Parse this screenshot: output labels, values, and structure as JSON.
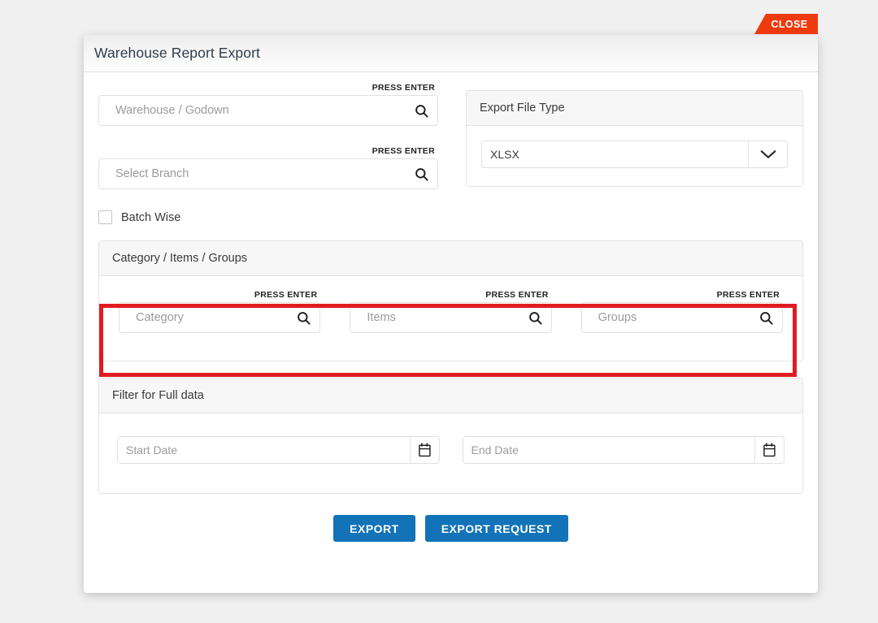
{
  "window": {
    "background_color": "#f0f0f0"
  },
  "close_button": {
    "label": "CLOSE",
    "color": "#ed3b0e"
  },
  "modal": {
    "title": "Warehouse Report Export"
  },
  "warehouse_field": {
    "placeholder": "Warehouse / Godown",
    "value": "",
    "hint": "PRESS ENTER",
    "icon": "search-icon"
  },
  "branch_field": {
    "placeholder": "Select Branch",
    "value": "",
    "hint": "PRESS ENTER",
    "icon": "search-icon"
  },
  "batch_wise": {
    "label": "Batch Wise",
    "checked": false
  },
  "export_file_type": {
    "panel_title": "Export File Type",
    "selected": "XLSX",
    "options": [
      "XLSX"
    ],
    "icon": "chevron-down-icon"
  },
  "category_panel": {
    "panel_title": "Category / Items / Groups",
    "fields": [
      {
        "placeholder": "Category",
        "value": "",
        "hint": "PRESS ENTER",
        "icon": "search-icon"
      },
      {
        "placeholder": "Items",
        "value": "",
        "hint": "PRESS ENTER",
        "icon": "search-icon"
      },
      {
        "placeholder": "Groups",
        "value": "",
        "hint": "PRESS ENTER",
        "icon": "search-icon"
      }
    ],
    "highlight_color": "#e01b22"
  },
  "filter_panel": {
    "panel_title": "Filter for Full data",
    "start_date": {
      "placeholder": "Start Date",
      "value": "",
      "icon": "calendar-icon"
    },
    "end_date": {
      "placeholder": "End Date",
      "value": "",
      "icon": "calendar-icon"
    }
  },
  "footer": {
    "export_label": "EXPORT",
    "export_request_label": "EXPORT REQUEST",
    "button_color": "#1273b8"
  }
}
